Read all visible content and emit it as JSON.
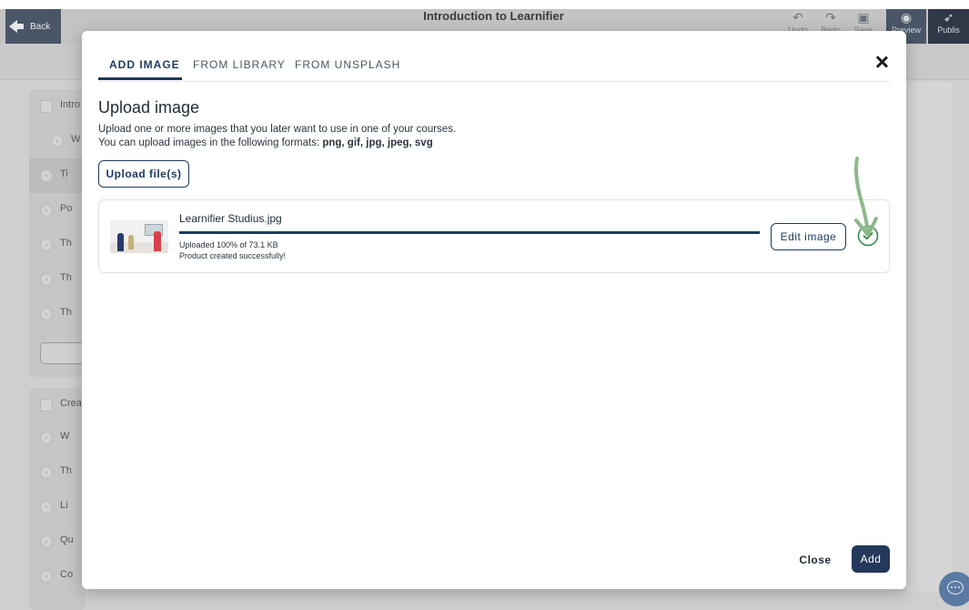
{
  "app": {
    "back_label": "Back",
    "title": "Introduction to Learnifier",
    "toolbar": {
      "undo": "Undo",
      "redo": "Redo",
      "save": "Save",
      "preview": "Preview",
      "publish": "Publis"
    },
    "outline_visible": [
      "Intro",
      "W",
      "Ti",
      "Po",
      "Th",
      "Th",
      "Th",
      "Crea",
      "W",
      "Th",
      "Li",
      "Qu",
      "Co"
    ]
  },
  "modal": {
    "tabs": [
      {
        "label": "ADD IMAGE",
        "active": true
      },
      {
        "label": "FROM LIBRARY",
        "active": false
      },
      {
        "label": "FROM UNSPLASH",
        "active": false
      }
    ],
    "heading": "Upload image",
    "description_line1": "Upload one or more images that you later want to use in one of your courses.",
    "description_line2_prefix": "You can upload images in the following formats: ",
    "description_formats": "png, gif, jpg, jpeg, svg",
    "upload_button": "Upload file(s)",
    "file": {
      "name": "Learnifier Studius.jpg",
      "progress": 1.0,
      "status_line1": "Uploaded 100% of 73.1 KB",
      "status_line2": "Product created successfully!",
      "edit_button": "Edit image"
    },
    "footer": {
      "close": "Close",
      "add": "Add"
    }
  },
  "colors": {
    "accent": "#1f3a5f",
    "success": "#3a8a4a",
    "annotation": "#8fb88a",
    "overlay": "#cfcfcf"
  },
  "icons": [
    "close-icon",
    "check-circle-icon",
    "back-arrow-icon",
    "undo-icon",
    "redo-icon",
    "save-icon",
    "preview-eye-icon",
    "publish-rocket-icon",
    "chat-icon"
  ]
}
